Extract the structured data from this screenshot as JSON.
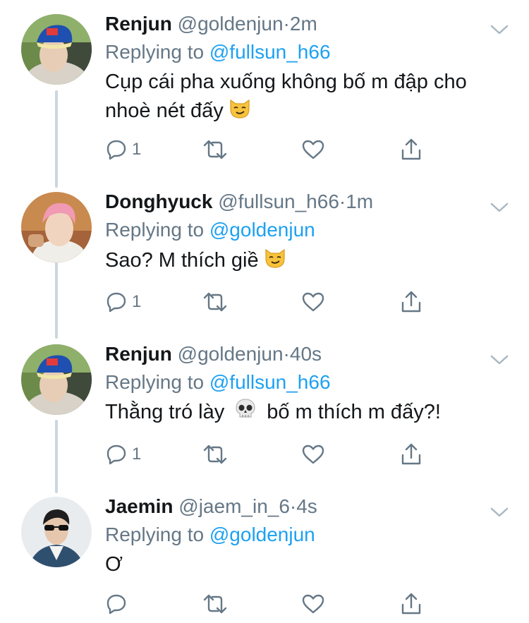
{
  "tweets": [
    {
      "name": "Renjun",
      "handle": "@goldenjun",
      "dot": "·",
      "time": "2m",
      "reply_prefix": "Replying to",
      "reply_to": "@fullsun_h66",
      "text_line1": "Cụp cái pha xuống không bố m đập cho",
      "text_line2": "nhoè nét đấy",
      "reply_count": "1"
    },
    {
      "name": "Donghyuck",
      "handle": "@fullsun_h66",
      "dot": "·",
      "time": "1m",
      "reply_prefix": "Replying to",
      "reply_to": "@goldenjun",
      "text_line1": "Sao? M thích giề",
      "reply_count": "1"
    },
    {
      "name": "Renjun",
      "handle": "@goldenjun",
      "dot": "·",
      "time": "40s",
      "reply_prefix": "Replying to",
      "reply_to": "@fullsun_h66",
      "text_part1": "Thằng tró lày",
      "text_part2": "bố m thích m đấy?!",
      "reply_count": "1"
    },
    {
      "name": "Jaemin",
      "handle": "@jaem_in_6",
      "dot": "·",
      "time": "4s",
      "reply_prefix": "Replying to",
      "reply_to": "@goldenjun",
      "text_line1": "Ơ",
      "reply_count": ""
    }
  ],
  "colors": {
    "link": "#1da1f2",
    "muted": "#657786",
    "thread": "#ccd6dd"
  }
}
